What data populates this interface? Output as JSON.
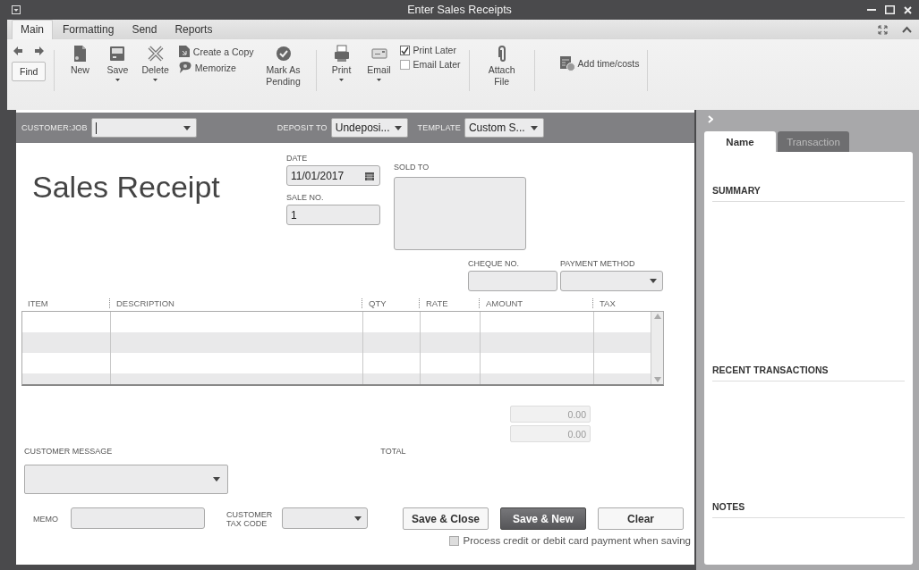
{
  "window": {
    "title": "Enter Sales Receipts"
  },
  "ribbon_tabs": [
    {
      "label": "Main",
      "selected": true
    },
    {
      "label": "Formatting",
      "selected": false
    },
    {
      "label": "Send",
      "selected": false
    },
    {
      "label": "Reports",
      "selected": false
    }
  ],
  "toolbar": [
    [
      {
        "kind": "find",
        "label": "Find"
      }
    ],
    [
      {
        "kind": "big",
        "label": "New",
        "menu": false
      },
      {
        "kind": "big",
        "label": "Save",
        "menu": true
      },
      {
        "kind": "big",
        "label": "Delete",
        "menu": true
      },
      {
        "kind": "pair",
        "items": [
          {
            "label": "Create a Copy"
          },
          {
            "label": "Memorize"
          }
        ]
      },
      {
        "kind": "big",
        "label": "Mark As Pending",
        "menu": false
      }
    ],
    [
      {
        "kind": "big",
        "label": "Print",
        "menu": true
      },
      {
        "kind": "big",
        "label": "Email",
        "menu": true
      },
      {
        "kind": "checks",
        "items": [
          {
            "label": "Print Later",
            "checked": true
          },
          {
            "label": "Email Later",
            "checked": false
          }
        ]
      }
    ],
    [
      {
        "kind": "big",
        "label": "Attach File",
        "menu": false
      }
    ],
    [
      {
        "kind": "small",
        "label": "Add time/costs"
      }
    ]
  ],
  "header_bar": {
    "customer_job": {
      "label": "CUSTOMER:JOB"
    },
    "deposit_to": {
      "label": "DEPOSIT TO",
      "value": "Undeposi..."
    },
    "template": {
      "label": "TEMPLATE",
      "value": "Custom S..."
    }
  },
  "form": {
    "title": "Sales Receipt",
    "date": {
      "label": "DATE",
      "value": "11/01/2017"
    },
    "sale_no": {
      "label": "SALE NO.",
      "value": "1"
    },
    "sold_to": {
      "label": "SOLD TO"
    },
    "cheque_no": {
      "label": "CHEQUE NO."
    },
    "payment_method": {
      "label": "PAYMENT METHOD"
    }
  },
  "table": {
    "columns": [
      "ITEM",
      "DESCRIPTION",
      "QTY",
      "RATE",
      "AMOUNT",
      "TAX"
    ]
  },
  "totals": {
    "values": [
      "0.00",
      "0.00"
    ],
    "label": "TOTAL"
  },
  "customer_message": {
    "label": "CUSTOMER MESSAGE"
  },
  "memo": {
    "label": "MEMO"
  },
  "customer_tax_code": {
    "label": "CUSTOMER TAX CODE"
  },
  "buttons": [
    {
      "label": "Save & Close",
      "kind": "outline"
    },
    {
      "label": "Save & New",
      "kind": "primary"
    },
    {
      "label": "Clear",
      "kind": "outline"
    }
  ],
  "process_card": {
    "label": "Process credit or debit card payment when saving",
    "checked": false
  },
  "side_panel": {
    "tabs": [
      {
        "label": "Name",
        "selected": true
      },
      {
        "label": "Transaction",
        "selected": false
      }
    ],
    "sections": [
      "SUMMARY",
      "RECENT TRANSACTIONS",
      "NOTES"
    ]
  }
}
